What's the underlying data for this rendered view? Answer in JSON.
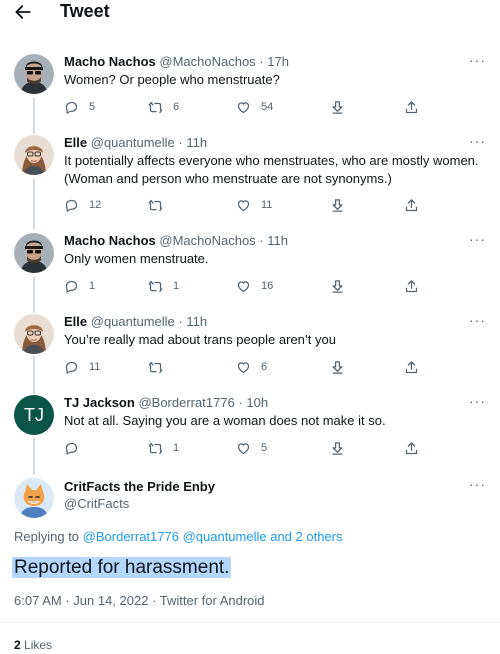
{
  "header": {
    "title": "Tweet"
  },
  "more_label": "···",
  "tweets": [
    {
      "name": "Macho Nachos",
      "handle": "@MachoNachos",
      "sep": "·",
      "time": "17h",
      "text": "Women? Or people who menstruate?",
      "replies": "5",
      "retweets": "6",
      "likes": "54"
    },
    {
      "name": "Elle",
      "handle": "@quantumelle",
      "sep": "·",
      "time": "11h",
      "text": "It potentially affects everyone who menstruates, who are mostly women. (Woman and person who menstruate are not synonyms.)",
      "replies": "12",
      "retweets": "",
      "likes": "11"
    },
    {
      "name": "Macho Nachos",
      "handle": "@MachoNachos",
      "sep": "·",
      "time": "11h",
      "text": "Only women menstruate.",
      "replies": "1",
      "retweets": "1",
      "likes": "16"
    },
    {
      "name": "Elle",
      "handle": "@quantumelle",
      "sep": "·",
      "time": "11h",
      "text": "You’re really mad about trans people aren’t you",
      "replies": "11",
      "retweets": "",
      "likes": "6"
    },
    {
      "name": "TJ Jackson",
      "handle": "@Borderrat1776",
      "sep": "·",
      "time": "10h",
      "avatar_initials": "TJ",
      "text": "Not at all.  Saying you are a woman does not make it so.",
      "replies": "",
      "retweets": "1",
      "likes": "5"
    }
  ],
  "main": {
    "name": "CritFacts the Pride Enby",
    "handle": "@CritFacts",
    "replying_prefix": "Replying to ",
    "replying_users": "@Borderrat1776 @quantumelle and 2 others",
    "text": "Reported for harassment.",
    "timestamp": "6:07 AM · Jun 14, 2022 · Twitter for Android",
    "likes_count": "2",
    "likes_label": "Likes"
  },
  "colors": {
    "link": "#1d9bf0",
    "secondary": "#536471",
    "highlight": "#b3d7ff",
    "tj_avatar": "#0b5448"
  }
}
